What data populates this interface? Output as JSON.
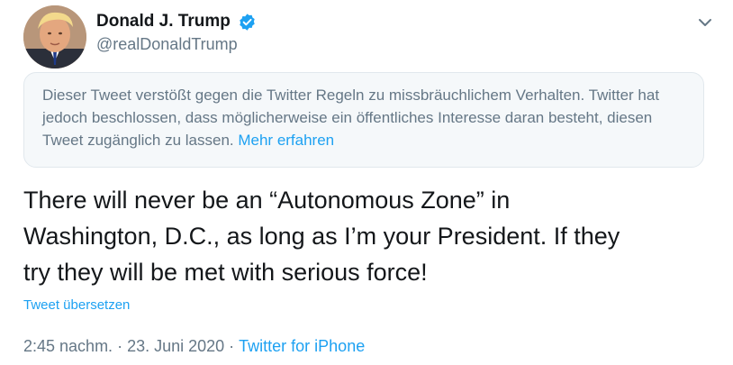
{
  "author": {
    "display_name": "Donald J. Trump",
    "handle": "@realDonaldTrump",
    "verified": true,
    "verified_icon": "verified-badge-icon",
    "avatar": "profile-avatar"
  },
  "menu": {
    "icon": "chevron-down-icon"
  },
  "notice": {
    "text": "Dieser Tweet verstößt gegen die Twitter Regeln zu missbräuchlichem Verhalten. Twitter hat jedoch beschlossen, dass möglicherweise ein öffentliches Interesse daran besteht, diesen Tweet zugänglich zu lassen. ",
    "link_label": "Mehr erfahren"
  },
  "tweet": {
    "text": "There will never be an “Autonomous Zone” in\nWashington, D.C., as long as I’m your President. If they\ntry they will be met with serious force!",
    "translate_label": "Tweet übersetzen",
    "time": "2:45 nachm.",
    "separator": "·",
    "date": "23. Juni 2020",
    "source": "Twitter for iPhone"
  },
  "colors": {
    "accent": "#1da1f2",
    "secondary_text": "#657786",
    "primary_text": "#14171a",
    "notice_bg": "#f5f8fa"
  }
}
